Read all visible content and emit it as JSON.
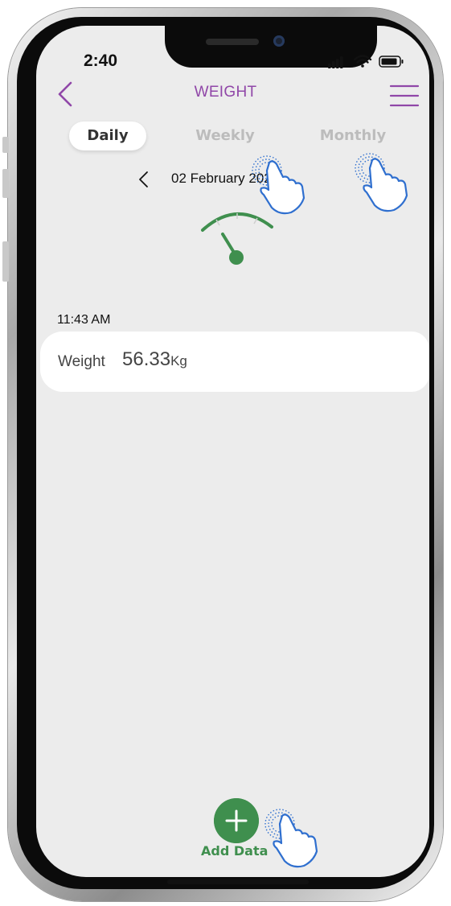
{
  "status_bar": {
    "time": "2:40"
  },
  "header": {
    "title": "WEIGHT",
    "back_icon": "chevron-left-icon",
    "menu_icon": "hamburger-menu-icon"
  },
  "tabs": [
    {
      "label": "Daily",
      "active": true
    },
    {
      "label": "Weekly",
      "active": false
    },
    {
      "label": "Monthly",
      "active": false
    }
  ],
  "date_nav": {
    "label": "02 February 2022",
    "prev_icon": "chevron-left-icon"
  },
  "gauge": {
    "icon": "weight-scale-gauge-icon"
  },
  "entries": [
    {
      "time": "11:43 AM",
      "label": "Weight",
      "value": "56.33",
      "unit": "Kg"
    }
  ],
  "add_button": {
    "label": "Add Data",
    "icon": "plus-icon"
  },
  "colors": {
    "accent_purple": "#9047a8",
    "accent_green": "#3f8f4e",
    "hand_blue": "#2f6fcf",
    "screen_bg": "#ececec"
  }
}
